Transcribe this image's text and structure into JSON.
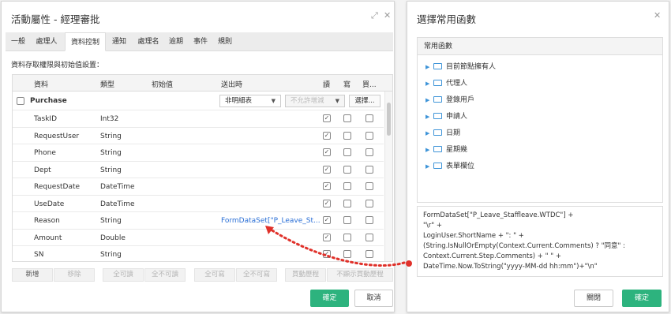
{
  "left_dialog": {
    "title": "活動屬性 - 經理審批",
    "tabs": [
      "一般",
      "處理人",
      "資料控制",
      "通知",
      "處理名",
      "逾期",
      "事件",
      "規則"
    ],
    "active_tab": "資料控制",
    "section_title": "資料存取權限與初始值設置：",
    "columns": [
      "資料",
      "類型",
      "初始值",
      "送出時",
      "讀",
      "寫",
      "買..."
    ],
    "group": {
      "name": "Purchase",
      "submit_select": "非明細表",
      "disabled_select": "不允許增減",
      "select_button": "選擇..."
    },
    "rows": [
      {
        "name": "TaskID",
        "type": "Int32",
        "submit": ""
      },
      {
        "name": "RequestUser",
        "type": "String",
        "submit": ""
      },
      {
        "name": "Phone",
        "type": "String",
        "submit": ""
      },
      {
        "name": "Dept",
        "type": "String",
        "submit": ""
      },
      {
        "name": "RequestDate",
        "type": "DateTime",
        "submit": ""
      },
      {
        "name": "UseDate",
        "type": "DateTime",
        "submit": ""
      },
      {
        "name": "Reason",
        "type": "String",
        "submit": "FormDataSet[\"P_Leave_St..."
      },
      {
        "name": "Amount",
        "type": "Double",
        "submit": ""
      },
      {
        "name": "SN",
        "type": "String",
        "submit": ""
      }
    ],
    "toolbar": {
      "add": "新增",
      "remove": "移除",
      "all_read": "全可讀",
      "none_read": "全不可讀",
      "all_write": "全可寫",
      "none_write": "全不可寫",
      "audit_history": "買動歷程",
      "hide_audit_history": "不顯示買動歷程"
    },
    "ok": "確定",
    "cancel": "取消"
  },
  "right_dialog": {
    "title": "選擇常用函數",
    "panel_header": "常用函數",
    "functions": [
      "目前節點擁有人",
      "代理人",
      "登錄用戶",
      "申請人",
      "日期",
      "星期幾",
      "表單欄位"
    ],
    "expression": [
      "FormDataSet[\"P_Leave_Staffleave.WTDC\"] +",
      "\"\\r\" +",
      "LoginUser.ShortName + \": \" +",
      "(String.IsNullOrEmpty(Context.Current.Comments) ? \"同意\" :",
      "Context.Current.Step.Comments) + \" \" +",
      "DateTime.Now.ToString(\"yyyy-MM-dd hh:mm\")+\"\\n\""
    ],
    "close": "關閉",
    "ok": "確定"
  },
  "colors": {
    "accent": "#2db37e",
    "link": "#2a6fd6",
    "arrow": "#e0312a",
    "folder": "#3e94d8"
  },
  "icons": [
    "expand-icon",
    "close-icon",
    "chevron-right-icon",
    "folder-icon",
    "dropdown-icon",
    "checkbox-checked-icon"
  ]
}
